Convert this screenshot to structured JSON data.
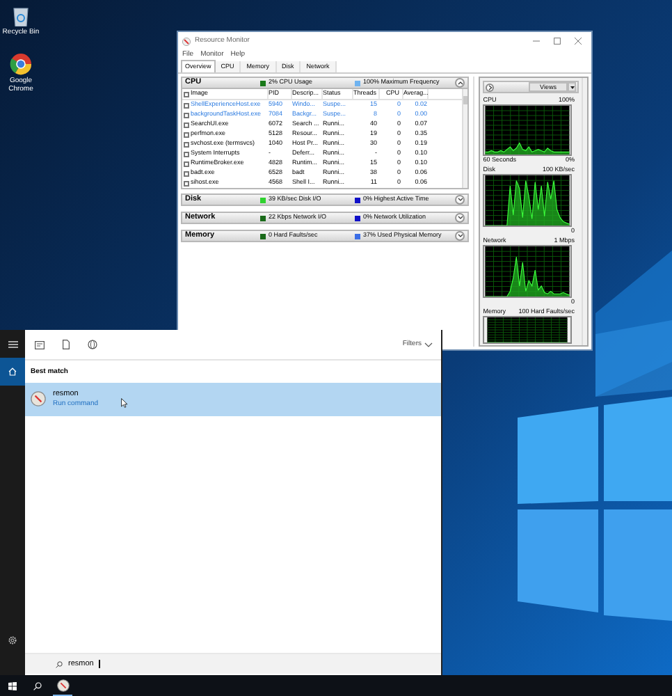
{
  "desktop_icons": [
    {
      "kind": "recycle",
      "label": "Recycle Bin"
    },
    {
      "kind": "browser",
      "label": "Google Chrome"
    }
  ],
  "resource_monitor": {
    "title": "Resource Monitor",
    "menu": [
      "File",
      "Monitor",
      "Help"
    ],
    "tabs": [
      {
        "label": "Overview",
        "selected": true
      },
      {
        "label": "CPU",
        "selected": false
      },
      {
        "label": "Memory",
        "selected": false
      },
      {
        "label": "Disk",
        "selected": false
      },
      {
        "label": "Network",
        "selected": false
      }
    ],
    "sections": [
      {
        "title": "CPU",
        "expanded": true,
        "stats": [
          {
            "text": "2% CPU Usage",
            "color": "#1a7a1a"
          },
          {
            "text": "100% Maximum Frequency",
            "color": "#6fb3f0"
          }
        ]
      },
      {
        "title": "Disk",
        "expanded": false,
        "stats": [
          {
            "text": "39 KB/sec Disk I/O",
            "color": "#2fd22f"
          },
          {
            "text": "0% Highest Active Time",
            "color": "#1010c8"
          }
        ]
      },
      {
        "title": "Network",
        "expanded": false,
        "stats": [
          {
            "text": "22 Kbps Network I/O",
            "color": "#1a6a1a"
          },
          {
            "text": "0% Network Utilization",
            "color": "#1010c8"
          }
        ]
      },
      {
        "title": "Memory",
        "expanded": false,
        "stats": [
          {
            "text": "0 Hard Faults/sec",
            "color": "#1a6a1a"
          },
          {
            "text": "37% Used Physical Memory",
            "color": "#3c6ee6"
          }
        ]
      }
    ],
    "table": {
      "all_checked": false,
      "columns": [
        "Image",
        "PID",
        "Descrip...",
        "Status",
        "Threads",
        "CPU",
        "Averag..."
      ],
      "rows": [
        {
          "checked": false,
          "suspended": true,
          "cells": [
            "ShellExperienceHost.exe",
            "5940",
            "Windo...",
            "Suspe...",
            "15",
            "0",
            "0.02"
          ]
        },
        {
          "checked": false,
          "suspended": true,
          "cells": [
            "backgroundTaskHost.exe",
            "7084",
            "Backgr...",
            "Suspe...",
            "8",
            "0",
            "0.00"
          ]
        },
        {
          "checked": false,
          "suspended": false,
          "cells": [
            "SearchUI.exe",
            "6072",
            "Search ...",
            "Runni...",
            "40",
            "0",
            "0.07"
          ]
        },
        {
          "checked": false,
          "suspended": false,
          "cells": [
            "perfmon.exe",
            "5128",
            "Resour...",
            "Runni...",
            "19",
            "0",
            "0.35"
          ]
        },
        {
          "checked": false,
          "suspended": false,
          "cells": [
            "svchost.exe (termsvcs)",
            "1040",
            "Host Pr...",
            "Runni...",
            "30",
            "0",
            "0.19"
          ]
        },
        {
          "checked": false,
          "suspended": false,
          "cells": [
            "System Interrupts",
            "-",
            "Deferr...",
            "Runni...",
            "-",
            "0",
            "0.10"
          ]
        },
        {
          "checked": false,
          "suspended": false,
          "cells": [
            "RuntimeBroker.exe",
            "4828",
            "Runtim...",
            "Runni...",
            "15",
            "0",
            "0.10"
          ]
        },
        {
          "checked": false,
          "suspended": false,
          "cells": [
            "badt.exe",
            "6528",
            "badt",
            "Runni...",
            "38",
            "0",
            "0.06"
          ]
        },
        {
          "checked": false,
          "suspended": false,
          "cells": [
            "sihost.exe",
            "4568",
            "Shell I...",
            "Runni...",
            "11",
            "0",
            "0.06"
          ]
        }
      ]
    },
    "views_button": "Views",
    "graphs": [
      {
        "title": "CPU",
        "scale": "100%",
        "time": "60 Seconds",
        "floor": "0%"
      },
      {
        "title": "Disk",
        "scale": "100 KB/sec",
        "floor": "0"
      },
      {
        "title": "Network",
        "scale": "1 Mbps",
        "floor": "0"
      },
      {
        "title": "Memory",
        "scale": "100 Hard Faults/sec"
      }
    ]
  },
  "start_menu": {
    "rail": [
      {
        "kind": "menu",
        "selected": false
      },
      {
        "kind": "home",
        "selected": true
      }
    ],
    "rail_bottom": [
      {
        "kind": "settings",
        "selected": false
      }
    ],
    "toolbar": [
      {
        "kind": "apps"
      },
      {
        "kind": "documents"
      },
      {
        "kind": "web"
      }
    ],
    "filters": "Filters",
    "heading": "Best match",
    "results": [
      {
        "title": "resmon",
        "subtitle": "Run command",
        "selected": true
      }
    ],
    "search": {
      "value": "resmon"
    }
  },
  "taskbar": [
    {
      "kind": "start",
      "running": false
    },
    {
      "kind": "search",
      "running": false
    },
    {
      "kind": "resmon",
      "running": true
    }
  ]
}
